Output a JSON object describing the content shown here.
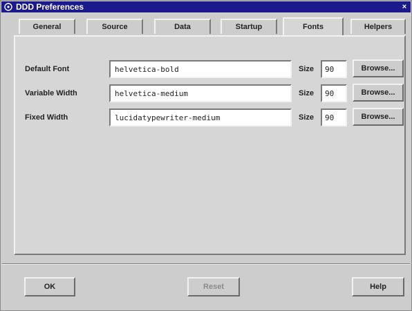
{
  "window": {
    "title": "DDD Preferences",
    "close_glyph": "×"
  },
  "tabs": [
    {
      "label": "General",
      "active": false
    },
    {
      "label": "Source",
      "active": false
    },
    {
      "label": "Data",
      "active": false
    },
    {
      "label": "Startup",
      "active": false
    },
    {
      "label": "Fonts",
      "active": true
    },
    {
      "label": "Helpers",
      "active": false
    }
  ],
  "fonts": {
    "size_label": "Size",
    "browse_label": "Browse...",
    "rows": [
      {
        "label": "Default Font",
        "value": "helvetica-bold",
        "size": "90"
      },
      {
        "label": "Variable Width",
        "value": "helvetica-medium",
        "size": "90"
      },
      {
        "label": "Fixed Width",
        "value": "lucidatypewriter-medium",
        "size": "90"
      }
    ]
  },
  "buttons": {
    "ok": "OK",
    "reset": "Reset",
    "help": "Help"
  },
  "colors": {
    "titlebar": "#1a1a8c",
    "background": "#cdcdcd",
    "field": "#ffffff"
  }
}
